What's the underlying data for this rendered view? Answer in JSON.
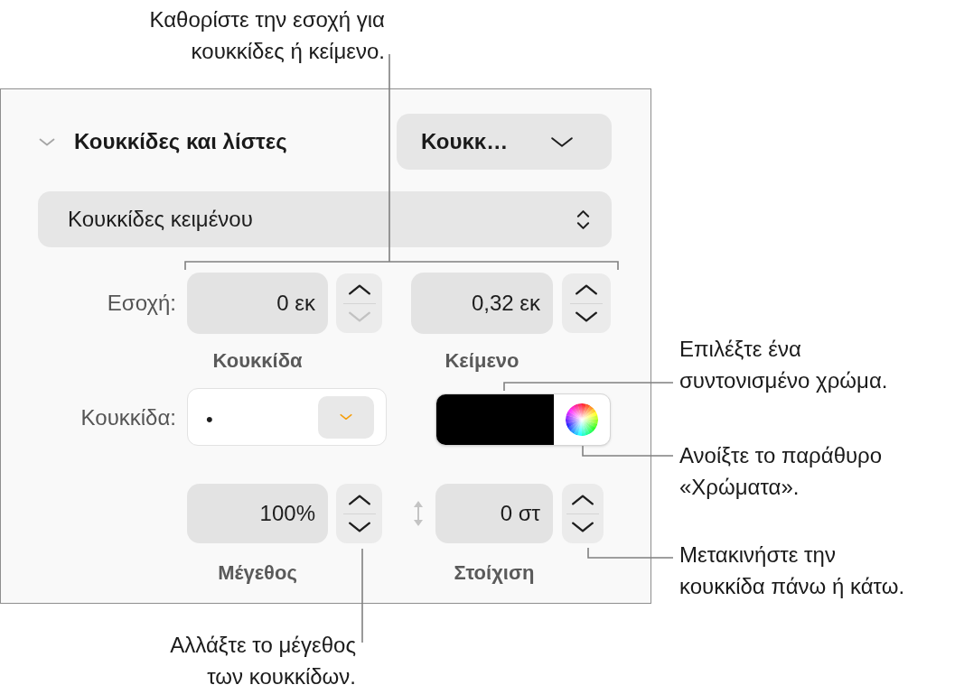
{
  "callouts": [
    {
      "text": "Καθορίστε την εσοχή για\nκουκκίδες ή κείμενο."
    },
    {
      "text": "Επιλέξτε ένα\nσυντονισμένο χρώμα."
    },
    {
      "text": "Ανοίξτε το παράθυρο\n«Χρώματα»."
    },
    {
      "text": "Μετακινήστε την\nκουκκίδα πάνω ή κάτω."
    },
    {
      "text": "Αλλάξτε το μέγεθος\nτων κουκκίδων."
    }
  ],
  "panel": {
    "header": {
      "title": "Κουκκίδες και λίστες",
      "expanded": true,
      "style_menu": "Κουκκ…"
    },
    "list_type_menu": "Κουκκίδες κειμένου",
    "indent": {
      "label": "Εσοχή:",
      "fields": [
        {
          "value": "0 εκ",
          "caption": "Κουκκίδα",
          "increment_disabled": false,
          "decrement_disabled": true
        },
        {
          "value": "0,32 εκ",
          "caption": "Κείμενο",
          "increment_disabled": false,
          "decrement_disabled": false
        }
      ]
    },
    "bullet": {
      "label": "Κουκκίδα:",
      "value": "•",
      "color": "#000000"
    },
    "size": {
      "value": "100%",
      "caption": "Μέγεθος",
      "increment_disabled": false,
      "decrement_disabled": false
    },
    "alignment": {
      "value": "0 στ",
      "caption": "Στοίχιση",
      "increment_disabled": false,
      "decrement_disabled": false
    }
  }
}
